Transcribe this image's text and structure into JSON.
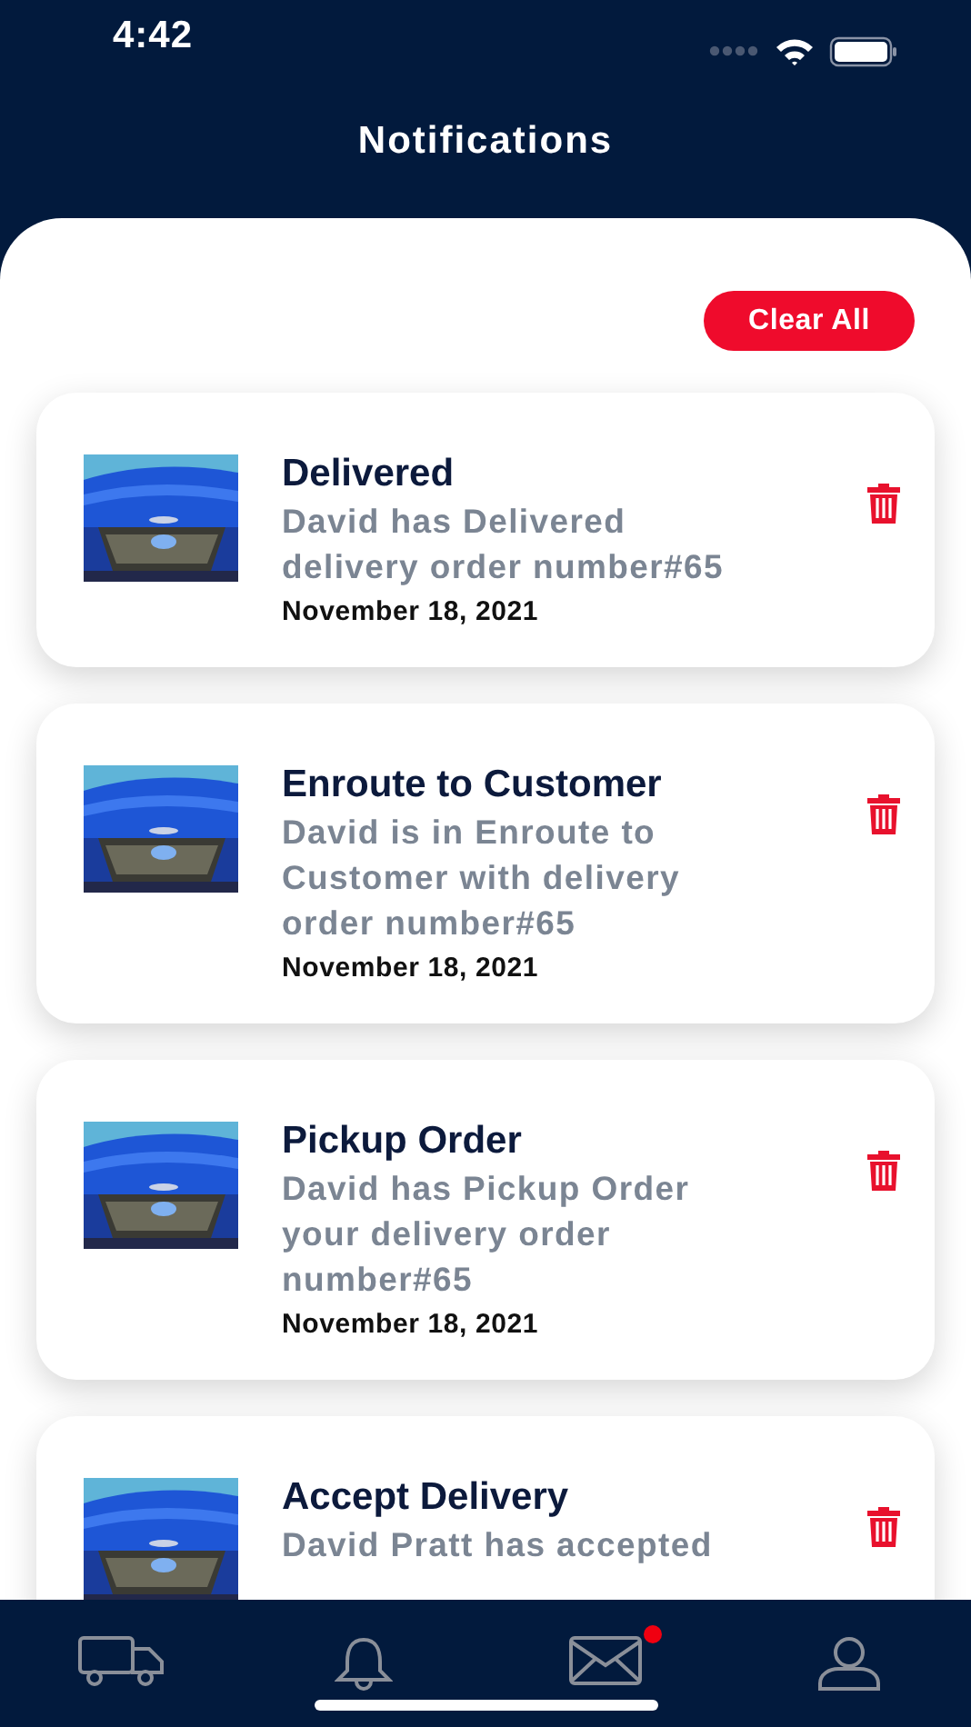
{
  "status_bar": {
    "time": "4:42"
  },
  "header": {
    "title": "Notifications"
  },
  "clear_button": {
    "label": "Clear All"
  },
  "notifications": [
    {
      "title": "Delivered",
      "message": "David has Delivered\ndelivery order number#65",
      "date": "November 18, 2021"
    },
    {
      "title": "Enroute to Customer",
      "message": "David is in Enroute to\nCustomer with delivery\norder number#65",
      "date": "November 18, 2021"
    },
    {
      "title": "Pickup Order",
      "message": "David has Pickup Order\nyour delivery order\nnumber#65",
      "date": "November 18, 2021"
    },
    {
      "title": "Accept Delivery",
      "message": "David Pratt has accepted"
    }
  ],
  "tab_bar": [
    {
      "kind": "truck",
      "badge": false
    },
    {
      "kind": "bell",
      "badge": false
    },
    {
      "kind": "mail",
      "badge": true
    },
    {
      "kind": "person",
      "badge": false
    }
  ]
}
